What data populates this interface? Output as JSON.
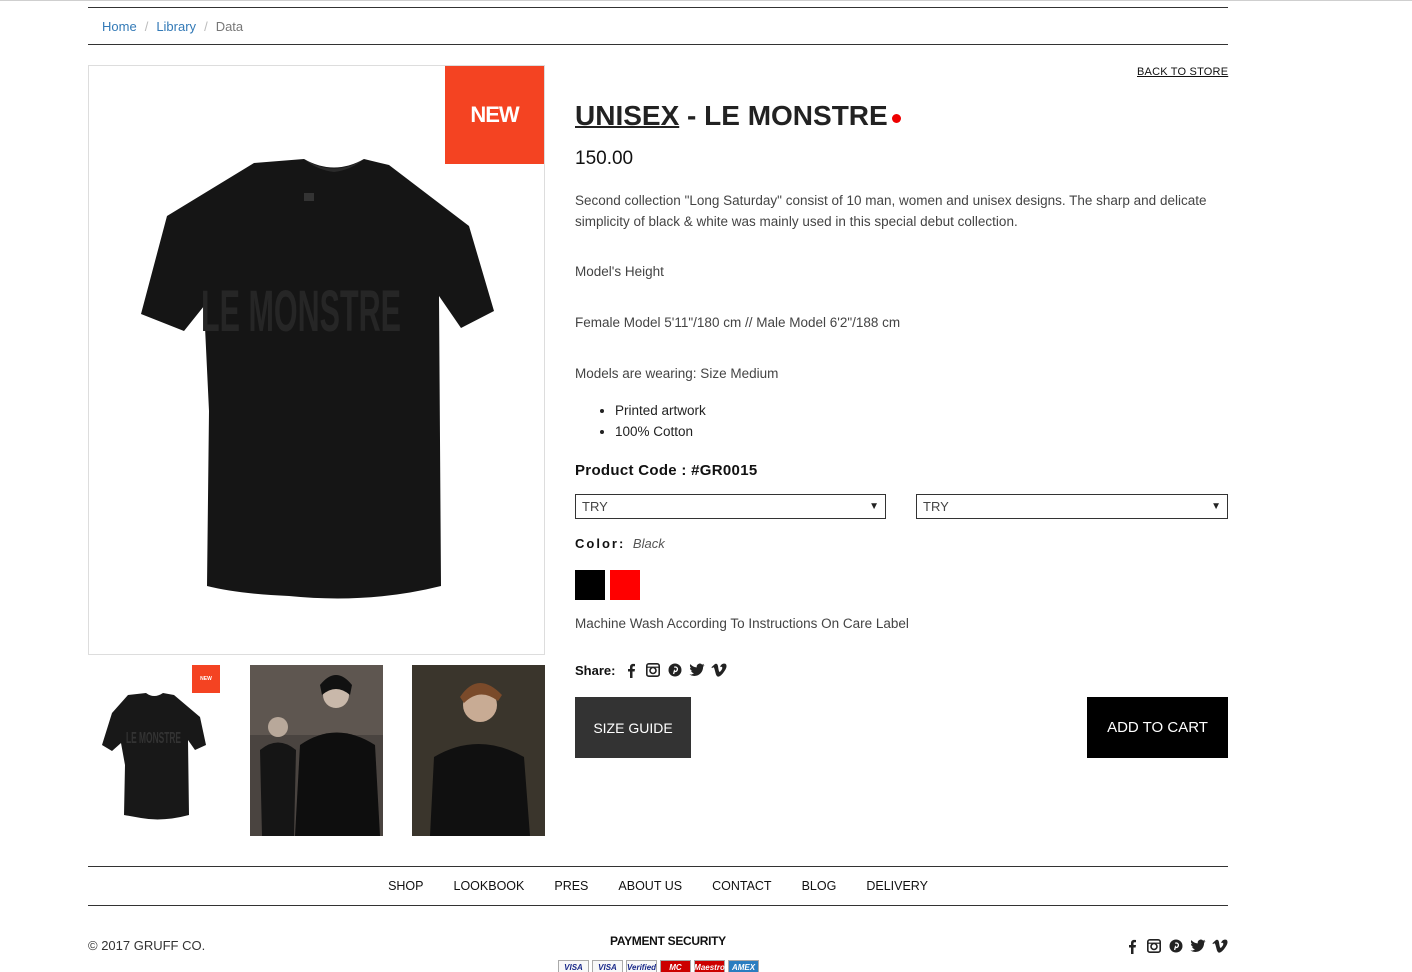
{
  "breadcrumb": {
    "home": "Home",
    "library": "Library",
    "current": "Data",
    "separator": "/"
  },
  "product": {
    "badge": "NEW",
    "back_link": "BACK TO STORE",
    "title_underlined": "UNISEX",
    "title_rest": " - LE MONSTRE",
    "price": "150.00",
    "description": "Second collection \"Long Saturday\" consist of 10 man, women and unisex designs. The sharp and delicate simplicity of black & white was mainly used in this special debut collection.",
    "models_height_label": "Model's Height",
    "models_height_value": "Female Model 5'11\"/180 cm // Male Model 6'2\"/188 cm",
    "models_wearing": "Models are wearing: Size Medium",
    "features": [
      "Printed artwork",
      "100% Cotton"
    ],
    "product_code": "Product Code : #GR0015",
    "select_1": "TRY",
    "select_2": "TRY",
    "color_label": "Color:",
    "color_value": "Black",
    "swatches": [
      "#000000",
      "#ff0000"
    ],
    "care": "Machine Wash According To Instructions On Care Label",
    "share_label": "Share:",
    "size_guide": "SIZE GUIDE",
    "add_to_cart": "ADD TO CART",
    "tshirt_print": "LE MONSTRE"
  },
  "footer": {
    "nav": [
      "SHOP",
      "LOOKBOOK",
      "PRES",
      "ABOUT US",
      "CONTACT",
      "BLOG",
      "DELIVERY"
    ],
    "copyright": "© 2017 GRUFF CO.",
    "payment_security": "PAYMENT SECURITY",
    "cards": [
      "VISA",
      "VISA",
      "Verified",
      "MC",
      "Maestro",
      "AMEX"
    ]
  },
  "colors": {
    "badge": "#f44322",
    "accent_dot": "#ee0000",
    "button_dark": "#333333",
    "button_black": "#000000"
  }
}
